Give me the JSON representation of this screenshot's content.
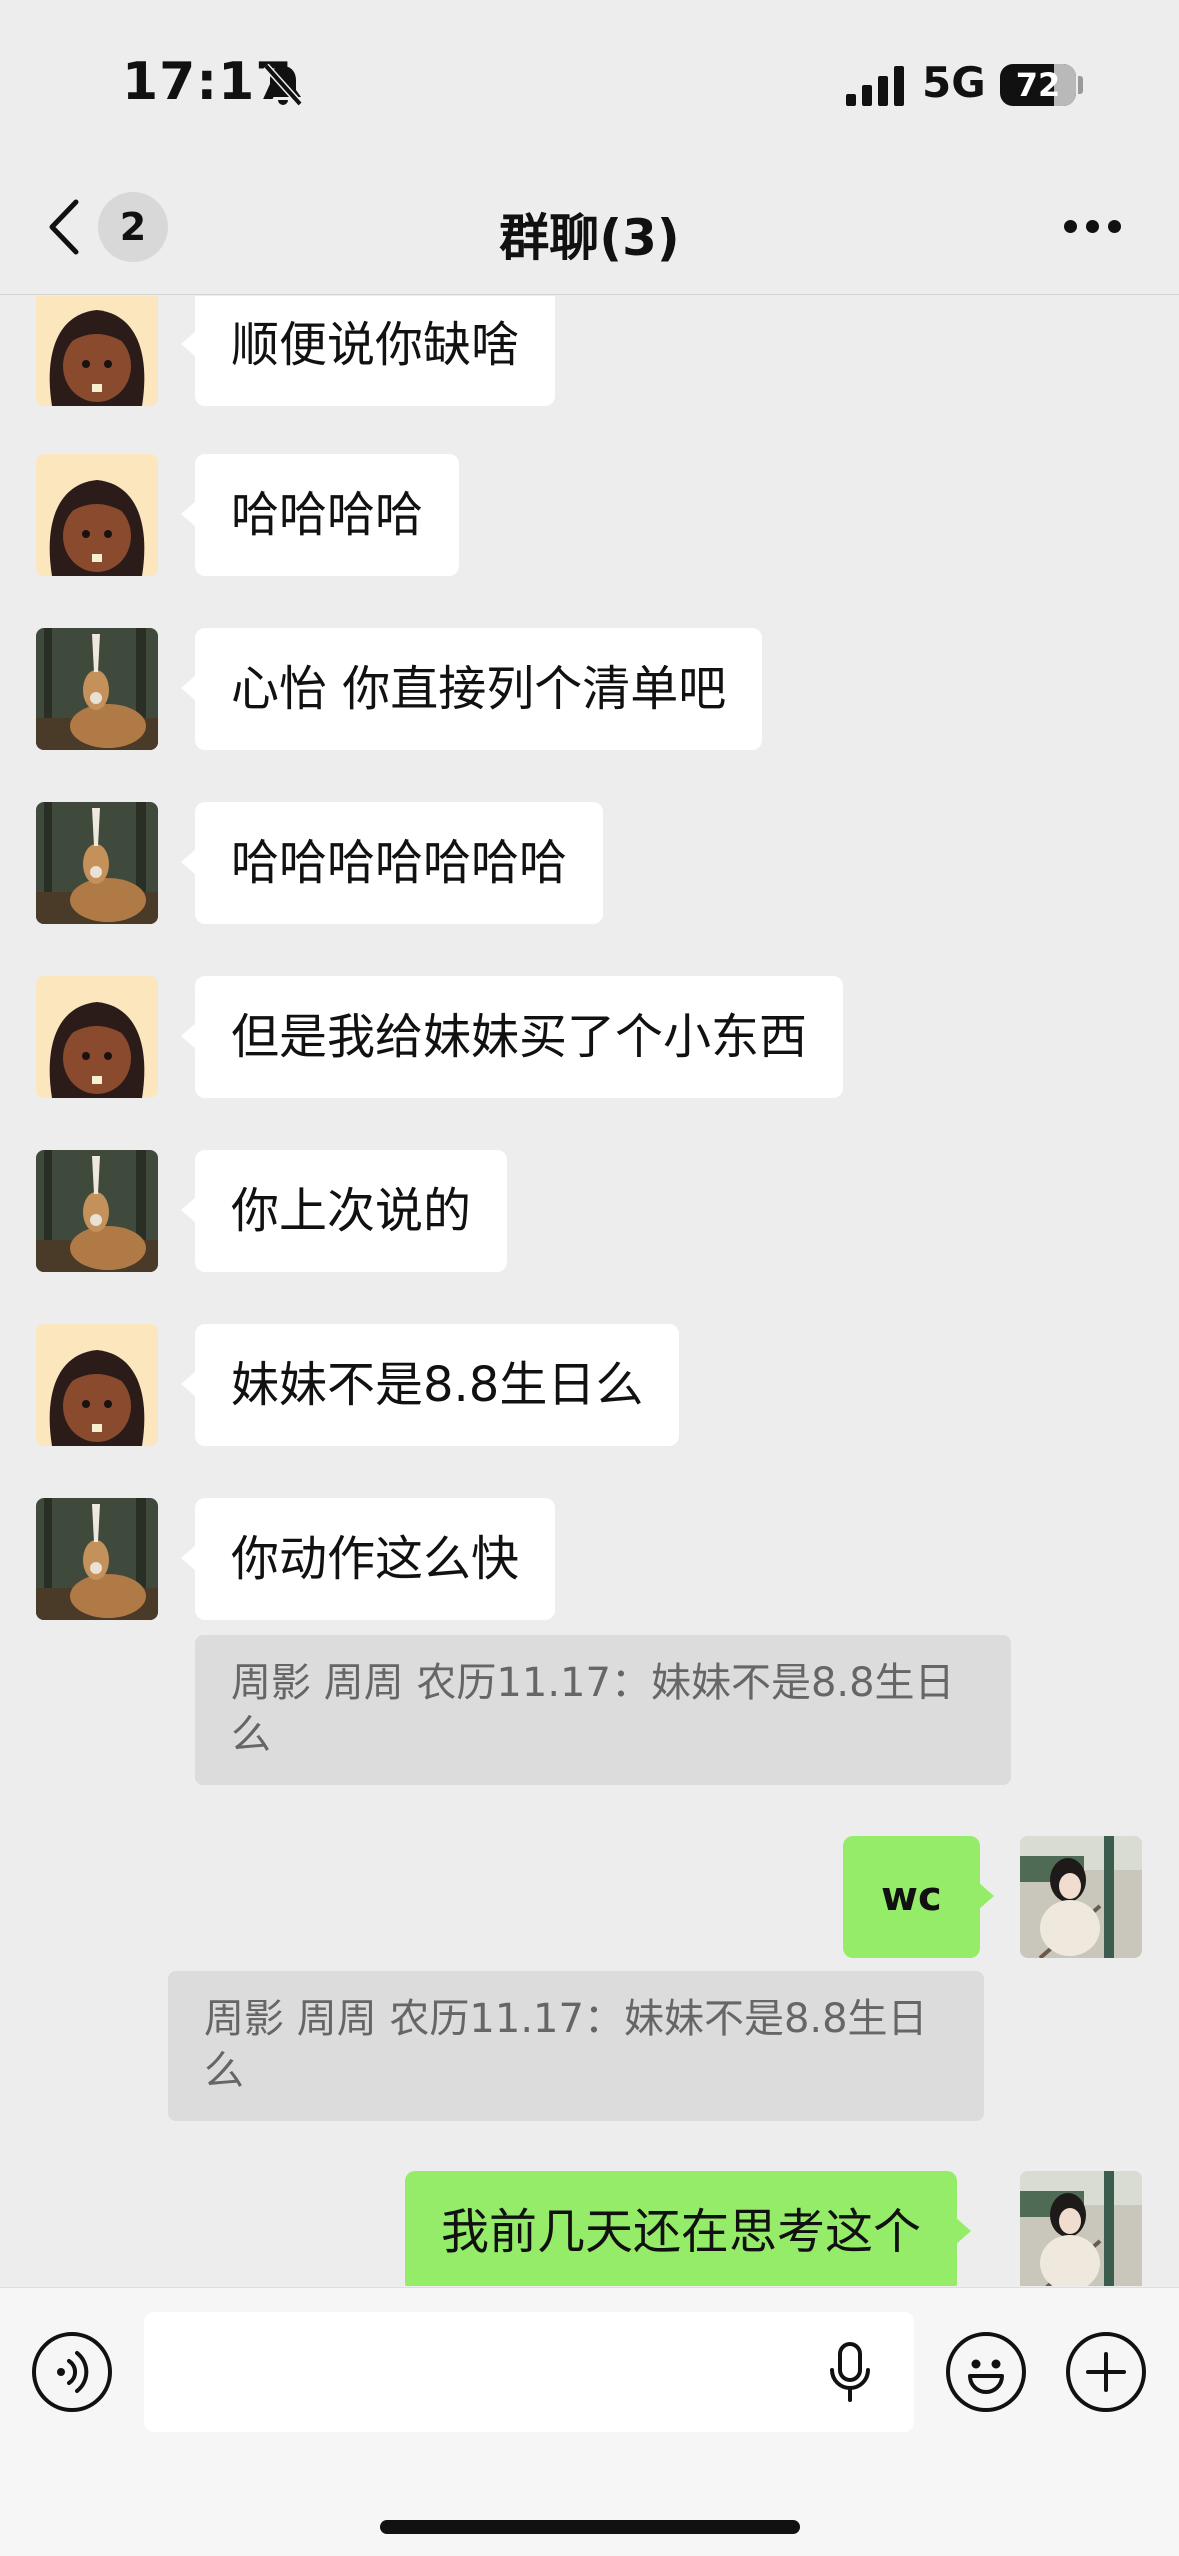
{
  "status_bar": {
    "time": "17:17",
    "network": "5G",
    "battery": "72"
  },
  "header": {
    "unread_count": "2",
    "title": "群聊(3)"
  },
  "messages": [
    {
      "sender": "girl-avatar",
      "direction": "in",
      "text": "顺便说你缺啥"
    },
    {
      "sender": "girl-avatar",
      "direction": "in",
      "text": "哈哈哈哈"
    },
    {
      "sender": "deer-avatar",
      "direction": "in",
      "text": "心怡  你直接列个清单吧"
    },
    {
      "sender": "deer-avatar",
      "direction": "in",
      "text": "哈哈哈哈哈哈哈"
    },
    {
      "sender": "girl-avatar",
      "direction": "in",
      "text": "但是我给妹妹买了个小东西"
    },
    {
      "sender": "deer-avatar",
      "direction": "in",
      "text": "你上次说的"
    },
    {
      "sender": "girl-avatar",
      "direction": "in",
      "text": "妹妹不是8.8生日么"
    },
    {
      "sender": "deer-avatar",
      "direction": "in",
      "text": "你动作这么快",
      "quote": "周影 周周 农历11.17：妹妹不是8.8生日么"
    },
    {
      "sender": "self-avatar",
      "direction": "out",
      "text": "wc",
      "quote": "周影 周周 农历11.17：妹妹不是8.8生日么"
    },
    {
      "sender": "self-avatar",
      "direction": "out",
      "text": "我前几天还在思考这个"
    }
  ],
  "input_bar": {
    "message_value": ""
  },
  "colors": {
    "background": "#ededed",
    "incoming_bubble": "#ffffff",
    "outgoing_bubble": "#95ec69",
    "quote_bg": "#dcdcdc"
  }
}
